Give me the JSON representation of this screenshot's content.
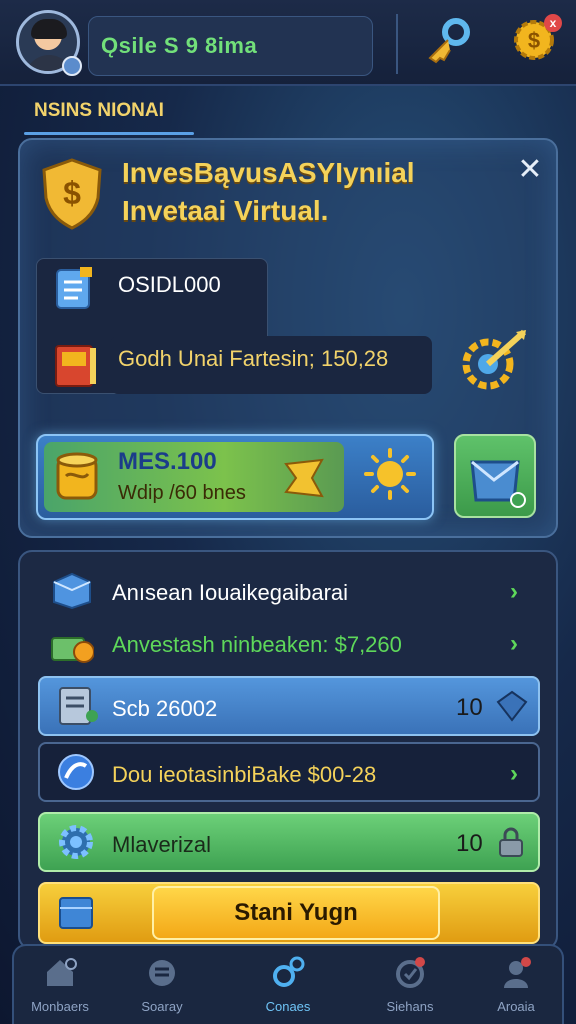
{
  "header": {
    "username": "Ǫsile S 9 8ima",
    "notification_count": "x"
  },
  "section_title": "NSINS NIONAI",
  "invest_panel": {
    "title_line1": "InvesBąvusASYIynıial",
    "title_line2": "Invetaai Virtual.",
    "close_label": "✕",
    "info_value": "OSIDL000",
    "info_profit": "Godh Unai Fartesin; 150,28",
    "plan_amount": "MES.100",
    "plan_sub": "Wdip /60 bnes"
  },
  "list": {
    "row1_label": "Anısean Iouaikegaibarai",
    "row2_label": "Anvestash ninbeaken: $7,260",
    "row3_label": "Scb 26002",
    "row3_num": "10",
    "row4_label": "Dou ieotasinbiBake $00-28",
    "row5_label": "Mlaverizal",
    "row5_num": "10",
    "start_label": "Stani Yugn"
  },
  "nav": {
    "items": [
      {
        "label": "Monbaers",
        "icon": "home-icon"
      },
      {
        "label": "Soaray",
        "icon": "coin-stack-icon"
      },
      {
        "label": "Conaes",
        "icon": "search-key-icon"
      },
      {
        "label": "Siehans",
        "icon": "trophy-icon"
      },
      {
        "label": "Aroaia",
        "icon": "person-icon"
      }
    ],
    "active_index": 2
  },
  "colors": {
    "accent_gold": "#f4d25a",
    "accent_green": "#5ed85a",
    "accent_blue": "#5496dc",
    "background": "#16294a"
  }
}
